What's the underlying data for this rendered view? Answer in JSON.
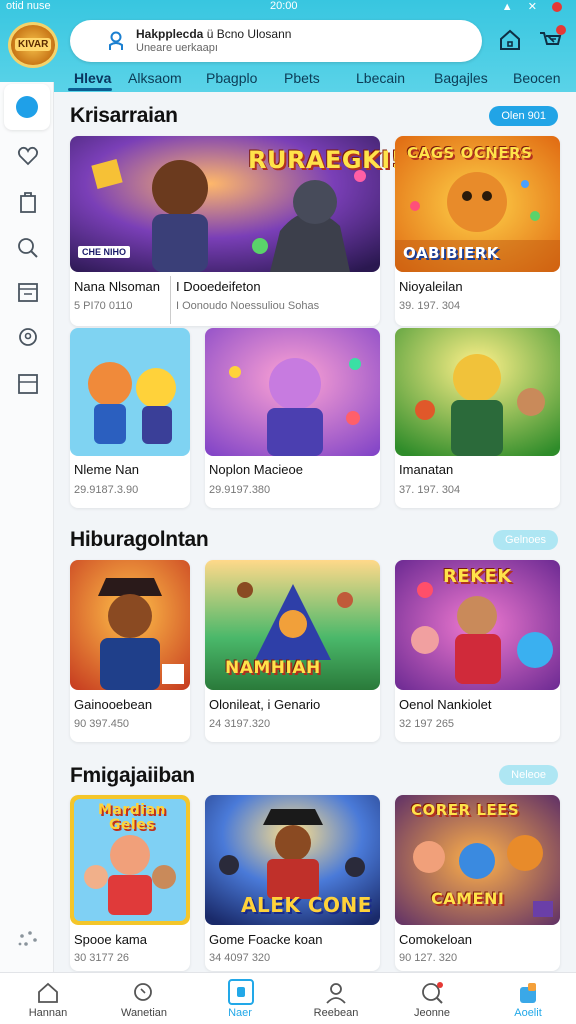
{
  "status": {
    "left": "otid nuse",
    "center": "20:00"
  },
  "logo_text": "KIVAR",
  "search": {
    "line1": "Hakpplecda",
    "line1_rest": "ü Bcno Ulosann",
    "line2": "Uneare uerkaapı"
  },
  "tabs": [
    "Hleva",
    "Alksaom",
    "Pbagplo",
    "Pbets",
    "Lbecain",
    "Bagajles",
    "Beocen"
  ],
  "sections": [
    {
      "title": "Krisarraian",
      "pill": "Olen 901",
      "cards": [
        {
          "title": "Nana Nlsoman",
          "sub": "5 PI70 0110",
          "banner": "RURAEGKI!",
          "tag": "CHE NIHO"
        },
        {
          "title": "I Dooedeifeton",
          "sub": "I Oonoudo Noessuliou Sohas",
          "banner": "",
          "tag": ""
        },
        {
          "title": "Nioyaleilan",
          "sub": "39. 197. 304",
          "banner": "OABIBIERK",
          "top": "CAGS OCNERS"
        },
        {
          "title": "Nleme Nan",
          "sub": "29.9187.3.90"
        },
        {
          "title": "Noplon Macieoe",
          "sub": "29.9197.380"
        },
        {
          "title": "Imanatan",
          "sub": "37. 197. 304"
        }
      ]
    },
    {
      "title": "Hiburagolntan",
      "pill": "Gelnoes",
      "cards": [
        {
          "title": "Gainooebean",
          "sub": "90 397.450"
        },
        {
          "title": "Olonileat, i Genario",
          "sub": "24 3197.320",
          "banner": "NAMHIAH"
        },
        {
          "title": "Oenol Nankiolet",
          "sub": "32 197 265",
          "banner": "REKEK"
        }
      ]
    },
    {
      "title": "Fmigajaiiban",
      "pill": "Neleoe",
      "cards": [
        {
          "title": "Spooe kama",
          "sub": "30 3177 26",
          "banner": "Mardian Geles"
        },
        {
          "title": "Gome Foacke koan",
          "sub": "34 4097 320",
          "banner": "ALEK CONE"
        },
        {
          "title": "Comokeloan",
          "sub": "90 127. 320",
          "banner": "CORER LEES",
          "bottom": "CAMENI"
        }
      ]
    }
  ],
  "bottom_nav": [
    "Hannan",
    "Wanetian",
    "Naer",
    "Reebean",
    "Jeonne",
    "Aoelit"
  ],
  "colors": {
    "header": "#38c6e0",
    "accent": "#21a4e6"
  }
}
